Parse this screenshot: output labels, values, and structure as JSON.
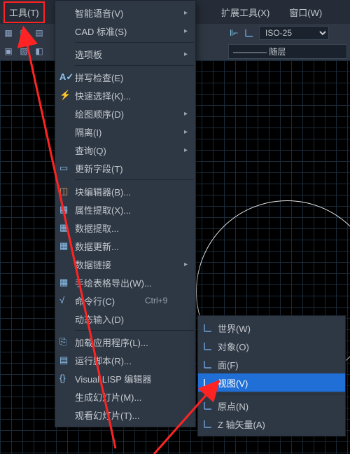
{
  "topbar": {
    "tool_menu": "工具(T)",
    "ext_tools": "扩展工具(X)",
    "window": "窗口(W)"
  },
  "ribbon": {
    "dimstyle": "ISO-25",
    "bylayer": "———— 随层"
  },
  "menu": {
    "voice": "智能语音(V)",
    "cadstd": "CAD 标准(S)",
    "palettes": "选项板",
    "spell": "拼写检查(E)",
    "qselect": "快速选择(K)...",
    "draworder": "绘图顺序(D)",
    "isolate": "隔离(I)",
    "inquiry": "查询(Q)",
    "updfield": "更新字段(T)",
    "bedit": "块编辑器(B)...",
    "attext": "属性提取(X)...",
    "dataext": "数据提取...",
    "dataupd": "数据更新...",
    "datalink": "数据链接",
    "tblexp": "手绘表格导出(W)...",
    "cmdline": "命令行(C)",
    "cmdline_sc": "Ctrl+9",
    "dyninput": "动态输入(D)",
    "appload": "加载应用程序(L)...",
    "script": "运行脚本(R)...",
    "vlisp": "Visual LISP 编辑器",
    "mkslide": "生成幻灯片(M)...",
    "vslide": "观看幻灯片(T)..."
  },
  "submenu": {
    "world": "世界(W)",
    "object": "对象(O)",
    "face": "面(F)",
    "view": "视图(V)",
    "origin": "原点(N)",
    "zaxis": "Z 轴矢量(A)"
  }
}
